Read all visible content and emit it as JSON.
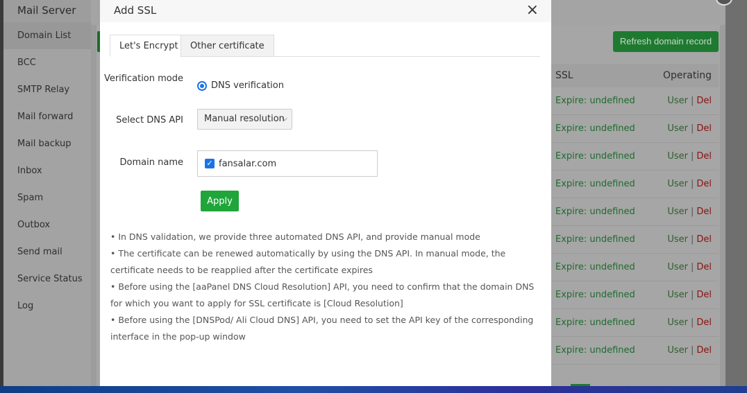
{
  "sidebar": {
    "title": "Mail Server",
    "items": [
      "Domain List",
      "BCC",
      "SMTP Relay",
      "Mail forward",
      "Mail backup",
      "Inbox",
      "Spam",
      "Outbox",
      "Send mail",
      "Service Status",
      "Log"
    ]
  },
  "main": {
    "refresh_label": "Refresh domain record",
    "table": {
      "headers": {
        "ssl": "SSL",
        "operating": "Operating"
      },
      "rows": [
        {
          "ssl": "Expire: undefined",
          "user": "User",
          "del": "Del"
        },
        {
          "ssl": "Expire: undefined",
          "user": "User",
          "del": "Del"
        },
        {
          "ssl": "Expire: undefined",
          "user": "User",
          "del": "Del"
        },
        {
          "ssl": "Expire: undefined",
          "user": "User",
          "del": "Del"
        },
        {
          "ssl": "Expire: undefined",
          "user": "User",
          "del": "Del"
        },
        {
          "ssl": "Expire: undefined",
          "user": "User",
          "del": "Del"
        },
        {
          "ssl": "Expire: undefined",
          "user": "User",
          "del": "Del"
        },
        {
          "ssl": "Expire: undefined",
          "user": "User",
          "del": "Del"
        },
        {
          "ssl": "Expire: undefined",
          "user": "User",
          "del": "Del"
        },
        {
          "ssl": "Expire: undefined",
          "user": "User",
          "del": "Del"
        }
      ]
    }
  },
  "modal": {
    "title": "Add SSL",
    "close": "×",
    "tabs": [
      "Let's Encrypt",
      "Other certificate"
    ],
    "verification_label": "Verification mode",
    "verification_value": "DNS verification",
    "dns_api_label": "Select DNS API",
    "dns_api_value": "Manual resolution",
    "domain_label": "Domain name",
    "domain_value": "fansalar.com",
    "apply": "Apply",
    "notes": [
      "• In DNS validation, we provide three automated DNS API, and provide manual mode",
      "• The certificate can be renewed automatically by using the DNS API. In manual mode, the certificate needs to be reapplied after the certificate expires",
      "• Before using the [aaPanel DNS Cloud Resolution] API, you need to confirm that the domain DNS for which you want to apply for SSL certificate is [Cloud Resolution]",
      "• Before using the [DNSPod/ Ali Cloud DNS] API, you need to set the API key of the corresponding interface in the pop-up window"
    ]
  }
}
